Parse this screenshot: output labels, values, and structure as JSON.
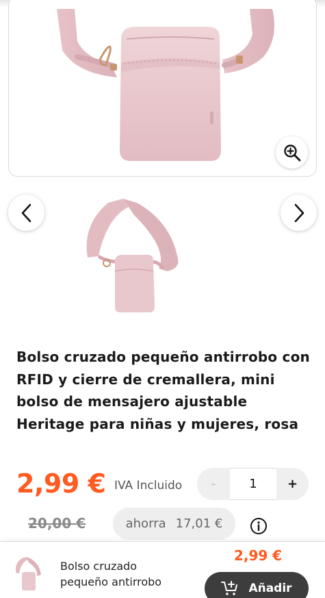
{
  "gallery": {
    "main_image_icon": "bag-photo",
    "zoom_icon": "zoom-in-icon",
    "prev_icon": "chevron-left-icon",
    "next_icon": "chevron-right-icon",
    "thumbnail_icon": "bag-thumbnail"
  },
  "product": {
    "title": "Bolso cruzado pequeño antirrobo con RFID y cierre de cremallera, mini bolso de mensajero ajustable Heritage para niñas y mujeres, rosa",
    "price": "2,99 €",
    "vat_label": "IVA Incluido",
    "old_price": "20,00 €",
    "savings_label": "ahorra",
    "savings_amount": "17,01 €",
    "info_icon": "info-icon"
  },
  "quantity": {
    "minus": "-",
    "value": "1",
    "plus": "+"
  },
  "sticky_bar": {
    "name_line1": "Bolso cruzado",
    "name_line2": "pequeño antirrobo",
    "price": "2,99 €",
    "add_label": "Añadir",
    "cart_icon": "cart-add-icon"
  },
  "colors": {
    "accent": "#ff5a1f",
    "bag_pink": "#e7c4c9",
    "button_dark": "#3d3d3d"
  }
}
